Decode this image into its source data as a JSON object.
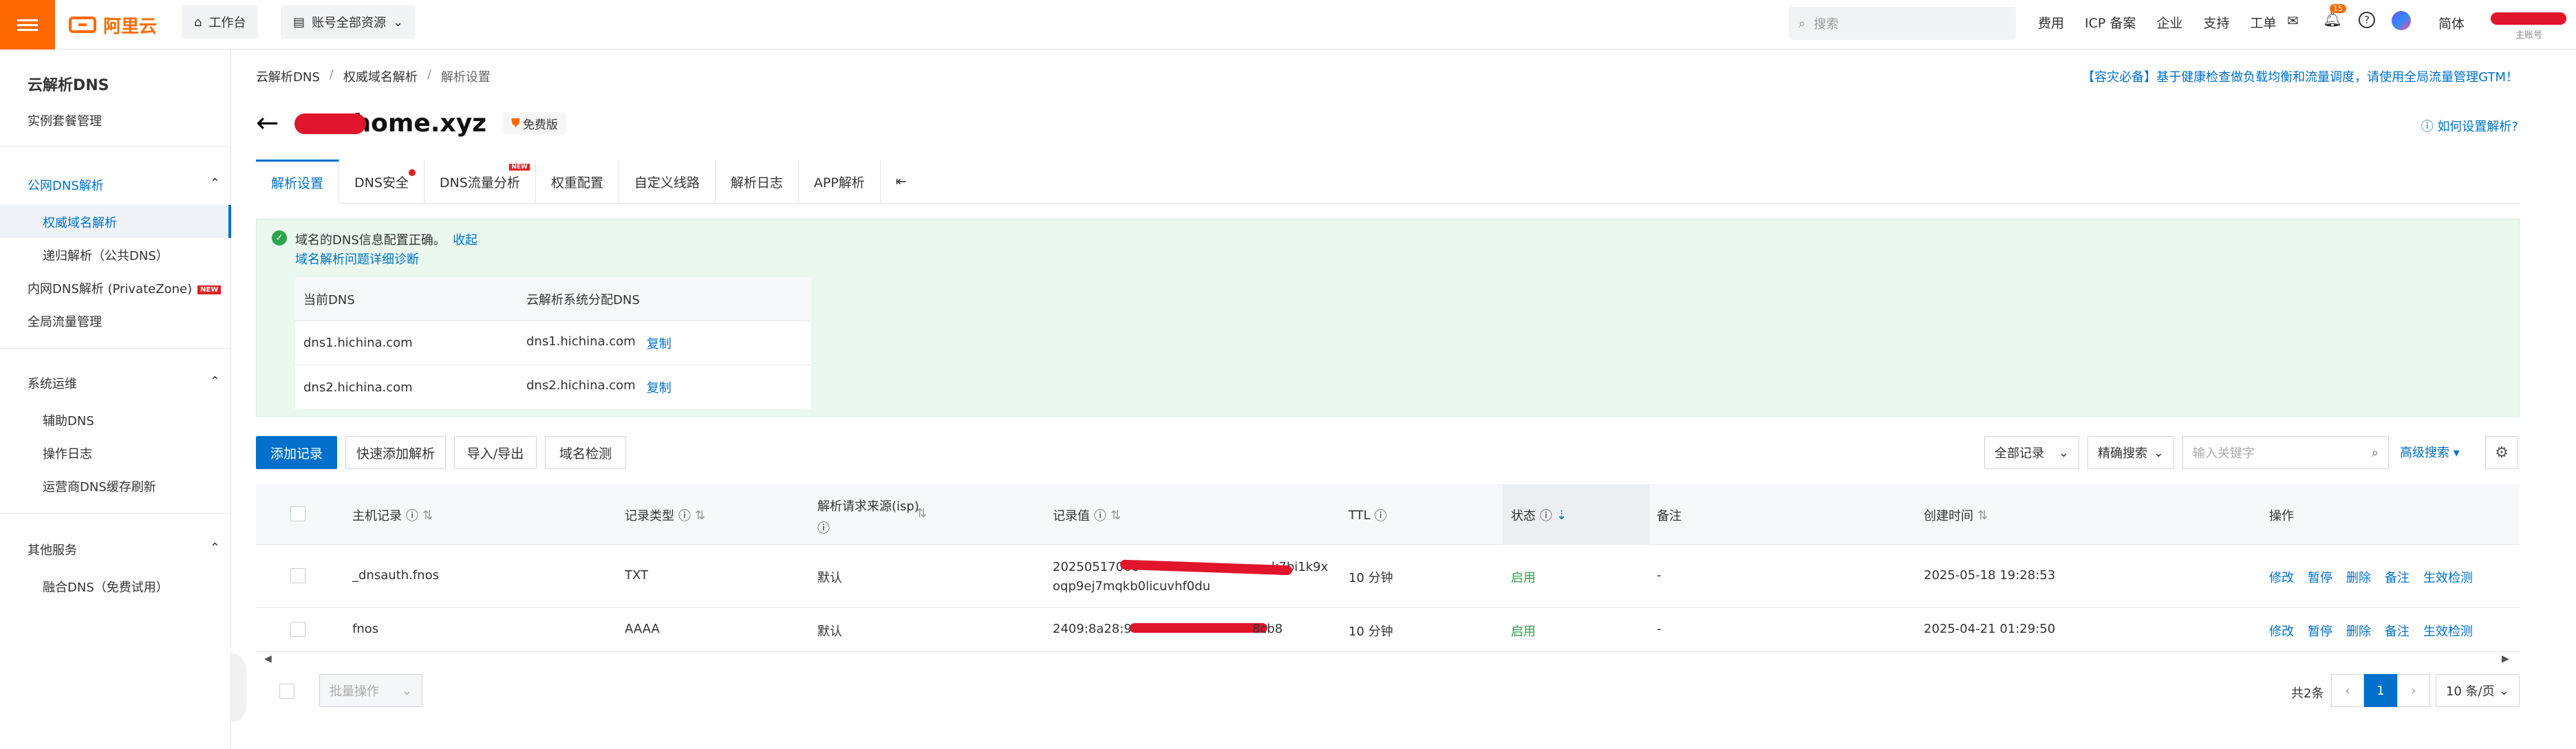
{
  "topbar": {
    "logo_text": "阿里云",
    "workbench": "工作台",
    "account_resources": "账号全部资源",
    "search_placeholder": "搜索",
    "nav": [
      "费用",
      "ICP 备案",
      "企业",
      "支持",
      "工单"
    ],
    "notification_count": "15",
    "lang": "简体",
    "account_sub": "主账号"
  },
  "sidebar": {
    "title": "云解析DNS",
    "instance_mgmt": "实例套餐管理",
    "public_dns": "公网DNS解析",
    "authoritative": "权威域名解析",
    "recursive": "递归解析（公共DNS）",
    "private_zone": "内网DNS解析 (PrivateZone)",
    "new_tag": "NEW",
    "global_traffic": "全局流量管理",
    "ops_group": "系统运维",
    "aux_dns": "辅助DNS",
    "op_log": "操作日志",
    "cache_refresh": "运营商DNS缓存刷新",
    "other_group": "其他服务",
    "fusion_dns": "融合DNS（免费试用）"
  },
  "breadcrumb": [
    "云解析DNS",
    "权威域名解析",
    "解析设置"
  ],
  "notice": "【容灾必备】基于健康检查做负载均衡和流量调度，请使用全局流量管理GTM！",
  "domain": {
    "name": "home.xyz",
    "plan": "免费版",
    "howto": "如何设置解析?"
  },
  "tabs": [
    {
      "label": "解析设置"
    },
    {
      "label": "DNS安全"
    },
    {
      "label": "DNS流量分析"
    },
    {
      "label": "权重配置"
    },
    {
      "label": "自定义线路"
    },
    {
      "label": "解析日志"
    },
    {
      "label": "APP解析"
    }
  ],
  "tab_new": "NEW",
  "status_panel": {
    "message": "域名的DNS信息配置正确。",
    "collapse": "收起",
    "diag": "域名解析问题详细诊断",
    "col_current": "当前DNS",
    "col_assigned": "云解析系统分配DNS",
    "rows": [
      {
        "current": "dns1.hichina.com",
        "assigned": "dns1.hichina.com"
      },
      {
        "current": "dns2.hichina.com",
        "assigned": "dns2.hichina.com"
      }
    ],
    "copy": "复制"
  },
  "toolbar": {
    "add": "添加记录",
    "quick_add": "快速添加解析",
    "import_export": "导入/导出",
    "domain_check": "域名检测",
    "all_records": "全部记录",
    "exact_search": "精确搜索",
    "keyword_placeholder": "输入关键字",
    "advanced": "高级搜索"
  },
  "table": {
    "headers": {
      "host": "主机记录",
      "type": "记录类型",
      "source": "解析请求来源(isp)",
      "value": "记录值",
      "ttl": "TTL",
      "status": "状态",
      "remark": "备注",
      "created": "创建时间",
      "actions": "操作"
    },
    "rows": [
      {
        "host": "_dnsauth.fnos",
        "type": "TXT",
        "source": "默认",
        "value_line1": "20250517000",
        "value_line1_tail": "k7bi1k9x",
        "value_line2": "oqp9ej7mqkb0licuvhf0du",
        "ttl": "10 分钟",
        "status": "启用",
        "remark": "-",
        "created": "2025-05-18 19:28:53"
      },
      {
        "host": "fnos",
        "type": "AAAA",
        "source": "默认",
        "value_line1": "2409:8a28:98",
        "value_line1_tail": "8cb8",
        "value_line2": "",
        "ttl": "10 分钟",
        "status": "启用",
        "remark": "-",
        "created": "2025-04-21 01:29:50"
      }
    ],
    "actions": [
      "修改",
      "暂停",
      "删除",
      "备注",
      "生效检测"
    ]
  },
  "footer": {
    "batch": "批量操作",
    "total": "共2条",
    "page": "1",
    "page_size": "10 条/页"
  },
  "colors": {
    "accent": "#0070cc",
    "brand": "#ff6a00",
    "success": "#2ba44c",
    "panel_bg": "#eaf8ef"
  }
}
